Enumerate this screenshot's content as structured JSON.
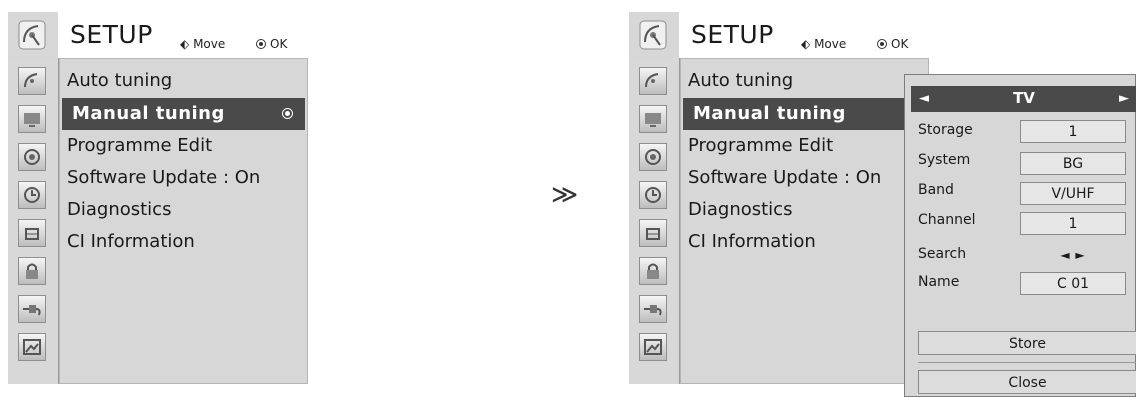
{
  "menu": {
    "title": "SETUP",
    "hint_move": "Move",
    "hint_ok": "OK",
    "items": [
      {
        "label": "Auto tuning"
      },
      {
        "label": "Manual tuning"
      },
      {
        "label": "Programme Edit"
      },
      {
        "label": "Software Update : On"
      },
      {
        "label": "Diagnostics"
      },
      {
        "label": "CI Information"
      }
    ],
    "categories": [
      "antenna-icon",
      "tv-screen-icon",
      "speaker-icon",
      "clock-icon",
      "lock-icon",
      "padlock-icon",
      "plug-icon",
      "picture-icon"
    ]
  },
  "step_arrow": "≫",
  "popup": {
    "source": "TV",
    "rows": [
      {
        "label": "Storage",
        "value": "1"
      },
      {
        "label": "System",
        "value": "BG"
      },
      {
        "label": "Band",
        "value": "V/UHF"
      },
      {
        "label": "Channel",
        "value": "1"
      },
      {
        "label": "Search",
        "value": "◄ ►"
      },
      {
        "label": "Name",
        "value": "C 01"
      }
    ],
    "store_label": "Store",
    "close_label": "Close"
  },
  "colors": {
    "panel_bg": "#d7d7d7",
    "highlight_bg": "#4a4a4a",
    "highlight_text": "#ffffff"
  }
}
